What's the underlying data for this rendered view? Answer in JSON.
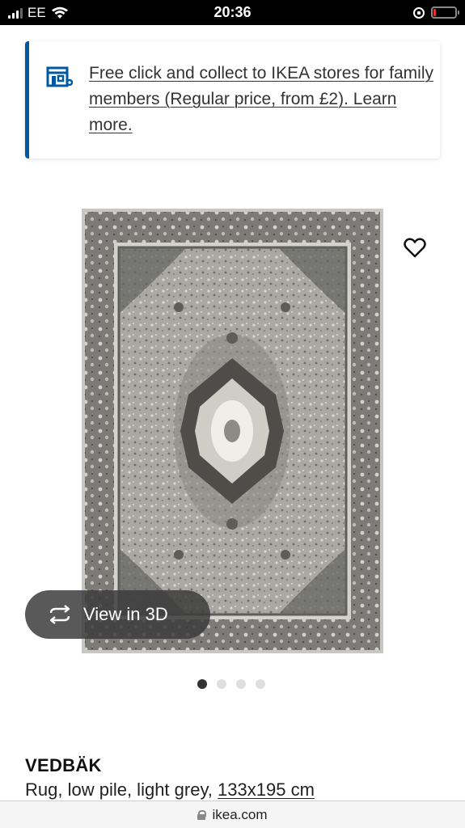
{
  "status_bar": {
    "carrier": "EE",
    "time": "20:36",
    "battery_color": "#e5332a"
  },
  "banner": {
    "text": "Free click and collect to IKEA stores for family members (Regular price, from £2). Learn more.",
    "accent_color": "#0058a3",
    "icon": "store-icon"
  },
  "gallery": {
    "view_3d_label": "View in 3D",
    "dot_count": 4,
    "active_dot": 0
  },
  "product": {
    "name": "VEDBÄK",
    "description": "Rug, low pile, light grey, ",
    "size": "133x195 cm"
  },
  "browser": {
    "url": "ikea.com"
  }
}
